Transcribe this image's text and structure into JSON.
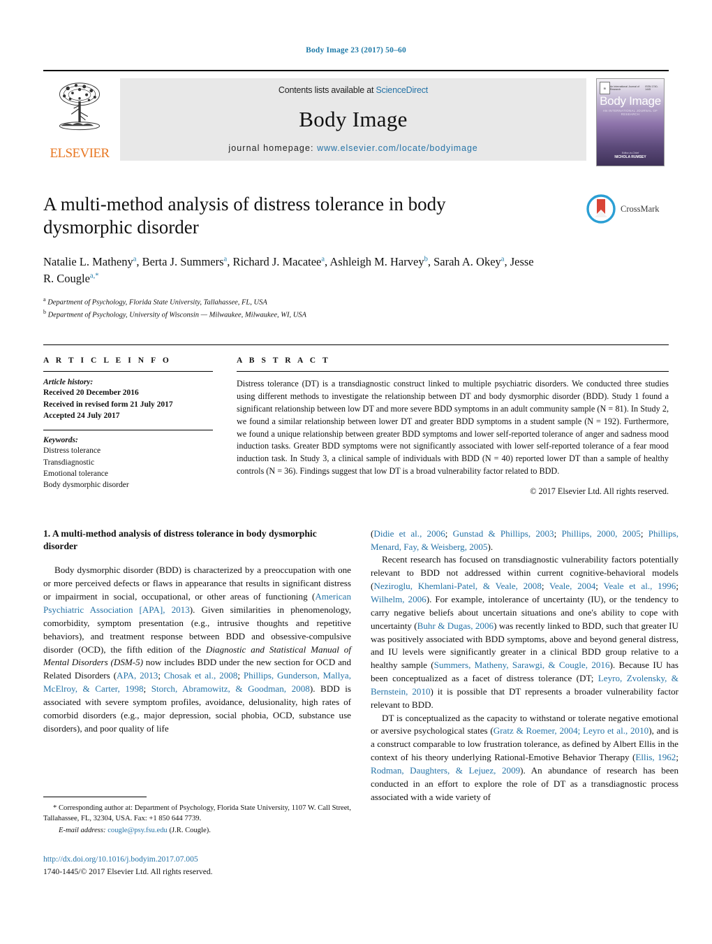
{
  "running_head": "Body Image 23 (2017) 50–60",
  "masthead": {
    "publisher_name": "ELSEVIER",
    "contents_prefix": "Contents lists available at ",
    "contents_link": "ScienceDirect",
    "journal_title": "Body Image",
    "homepage_prefix": "journal homepage: ",
    "homepage_url": "www.elsevier.com/locate/bodyimage",
    "cover": {
      "logo_text": "BI",
      "top_left_text": "An International Journal of Research",
      "top_right_text": "ISSN 1740-1445",
      "title": "Body Image",
      "subtitle": "AN INTERNATIONAL JOURNAL OF RESEARCH",
      "footer_line1": "Editor-in-Chief",
      "footer_line2": "NICHOLA RUMSEY"
    }
  },
  "article": {
    "title": "A multi-method analysis of distress tolerance in body dysmorphic disorder",
    "authors": [
      {
        "name": "Natalie L. Matheny",
        "marks": "a",
        "sep": ", "
      },
      {
        "name": "Berta J. Summers",
        "marks": "a",
        "sep": ", "
      },
      {
        "name": "Richard J. Macatee",
        "marks": "a",
        "sep": ", "
      },
      {
        "name": "Ashleigh M. Harvey",
        "marks": "b",
        "sep": ", "
      },
      {
        "name": "Sarah A. Okey",
        "marks": "a",
        "sep": ", "
      },
      {
        "name": "Jesse R. Cougle",
        "marks": "a,*",
        "sep": ""
      }
    ],
    "affiliations": [
      {
        "mark": "a",
        "text": "Department of Psychology, Florida State University, Tallahassee, FL, USA"
      },
      {
        "mark": "b",
        "text": "Department of Psychology, University of Wisconsin — Milwaukee, Milwaukee, WI, USA"
      }
    ],
    "crossmark_label": "CrossMark"
  },
  "article_info": {
    "heading": "A R T I C L E    I N F O",
    "history_heading": "Article history:",
    "history": [
      "Received 20 December 2016",
      "Received in revised form 21 July 2017",
      "Accepted 24 July 2017"
    ],
    "keywords_heading": "Keywords:",
    "keywords": [
      "Distress tolerance",
      "Transdiagnostic",
      "Emotional tolerance",
      "Body dysmorphic disorder"
    ]
  },
  "abstract": {
    "heading": "A B S T R A C T",
    "text": "Distress tolerance (DT) is a transdiagnostic construct linked to multiple psychiatric disorders. We conducted three studies using different methods to investigate the relationship between DT and body dysmorphic disorder (BDD). Study 1 found a significant relationship between low DT and more severe BDD symptoms in an adult community sample (N = 81). In Study 2, we found a similar relationship between lower DT and greater BDD symptoms in a student sample (N = 192). Furthermore, we found a unique relationship between greater BDD symptoms and lower self-reported tolerance of anger and sadness mood induction tasks. Greater BDD symptoms were not significantly associated with lower self-reported tolerance of a fear mood induction task. In Study 3, a clinical sample of individuals with BDD (N = 40) reported lower DT than a sample of healthy controls (N = 36). Findings suggest that low DT is a broad vulnerability factor related to BDD.",
    "copyright": "© 2017 Elsevier Ltd. All rights reserved."
  },
  "body": {
    "section_heading": "1.  A multi-method analysis of distress tolerance in body dysmorphic disorder",
    "left_paragraph_1": {
      "seg1": "Body dysmorphic disorder (BDD) is characterized by a preoccupation with one or more perceived defects or flaws in appearance that results in significant distress or impairment in social, occupational, or other areas of functioning (",
      "cite1": "American Psychiatric Association [APA], 2013",
      "seg2": "). Given similarities in phenomenology, comorbidity, symptom presentation (e.g., intrusive thoughts and repetitive behaviors), and treatment response between BDD and obsessive-compulsive disorder (OCD), the fifth edition of the ",
      "ital1": "Diagnostic and Statistical Manual of Mental Disorders (DSM-5)",
      "seg3": " now includes BDD under the new section for OCD and Related Disorders (",
      "cite2": "APA, 2013",
      "seg4": "; ",
      "cite3": "Chosak et al., 2008",
      "seg5": "; ",
      "cite4": "Phillips, Gunderson, Mallya, McElroy, & Carter, 1998",
      "seg6": "; ",
      "cite5": "Storch, Abramowitz, & Goodman, 2008",
      "seg7": "). BDD is associated with severe symptom profiles, avoidance, delusionality, high rates of comorbid disorders (e.g., major depression, social phobia, OCD, substance use disorders), and poor quality of life"
    },
    "right_continuation": {
      "open": "(",
      "cite1": "Didie et al., 2006",
      "s1": "; ",
      "cite2": "Gunstad & Phillips, 2003",
      "s2": "; ",
      "cite3": "Phillips, 2000, 2005",
      "s3": "; ",
      "cite4": "Phillips, Menard, Fay, & Weisberg, 2005",
      "close": ")."
    },
    "right_paragraph_2": {
      "seg1": "Recent research has focused on transdiagnostic vulnerability factors potentially relevant to BDD not addressed within current cognitive-behavioral models (",
      "cite1": "Neziroglu, Khemlani-Patel, & Veale, 2008",
      "seg2": "; ",
      "cite2": "Veale, 2004",
      "seg3": "; ",
      "cite3": "Veale et al., 1996",
      "seg4": "; ",
      "cite4": "Wilhelm, 2006",
      "seg5": "). For example, intolerance of uncertainty (IU), or the tendency to carry negative beliefs about uncertain situations and one's ability to cope with uncertainty (",
      "cite5": "Buhr & Dugas, 2006",
      "seg6": ") was recently linked to BDD, such that greater IU was positively associated with BDD symptoms, above and beyond general distress, and IU levels were significantly greater in a clinical BDD group relative to a healthy sample (",
      "cite6": "Summers, Matheny, Sarawgi, & Cougle, 2016",
      "seg7": "). Because IU has been conceptualized as a facet of distress tolerance (DT; ",
      "cite7": "Leyro, Zvolensky, & Bernstein, 2010",
      "seg8": ") it is possible that DT represents a broader vulnerability factor relevant to BDD."
    },
    "right_paragraph_3": {
      "seg1": "DT is conceptualized as the capacity to withstand or tolerate negative emotional or aversive psychological states (",
      "cite1": "Gratz & Roemer, 2004; Leyro et al., 2010",
      "seg2": "), and is a construct comparable to low frustration tolerance, as defined by Albert Ellis in the context of his theory underlying Rational-Emotive Behavior Therapy (",
      "cite2": "Ellis, 1962",
      "seg3": "; ",
      "cite3": "Rodman, Daughters, & Lejuez, 2009",
      "seg4": "). An abundance of research has been conducted in an effort to explore the role of DT as a transdiagnostic process associated with a wide variety of"
    }
  },
  "footnotes": {
    "corresponding": "* Corresponding author at: Department of Psychology, Florida State University, 1107 W. Call Street, Tallahassee, FL, 32304, USA. Fax: +1 850 644 7739.",
    "email_label": "E-mail address:",
    "email_address": "cougle@psy.fsu.edu",
    "email_attrib": "(J.R. Cougle).",
    "doi": "http://dx.doi.org/10.1016/j.bodyim.2017.07.005",
    "issn_line": "1740-1445/© 2017 Elsevier Ltd. All rights reserved."
  },
  "colors": {
    "link": "#2573a7",
    "running_head": "#1f7aa8",
    "elsevier_orange": "#E87722"
  }
}
